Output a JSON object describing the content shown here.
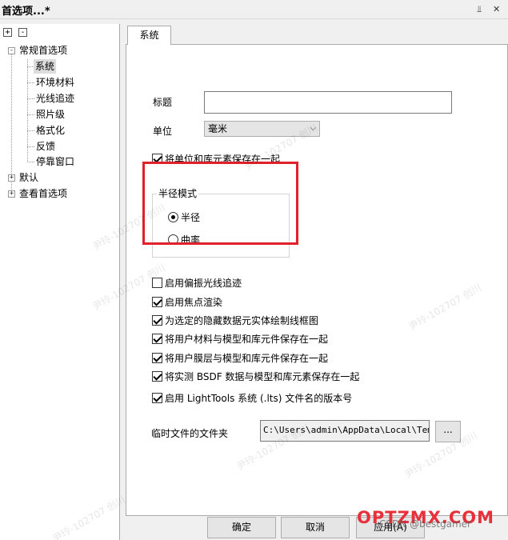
{
  "window": {
    "title": "首选项...*",
    "pin_icon": "pin-icon",
    "close_icon": "close-icon"
  },
  "tree": {
    "expand_all": "+",
    "collapse_all": "-",
    "items": [
      {
        "label": "常规首选项",
        "level": 0,
        "expanded": true
      },
      {
        "label": "系统",
        "level": 1,
        "selected": true
      },
      {
        "label": "环境材料",
        "level": 1
      },
      {
        "label": "光线追迹",
        "level": 1
      },
      {
        "label": "照片级",
        "level": 1
      },
      {
        "label": "格式化",
        "level": 1
      },
      {
        "label": "反馈",
        "level": 1
      },
      {
        "label": "停靠窗口",
        "level": 1
      },
      {
        "label": "默认",
        "level": 0,
        "expanded": false
      },
      {
        "label": "查看首选项",
        "level": 0,
        "expanded": false
      }
    ]
  },
  "tab": {
    "label": "系统"
  },
  "form": {
    "title_label": "标题",
    "title_value": "",
    "unit_label": "单位",
    "unit_value": "毫米",
    "save_units_label": "将单位和库元素保存在一起",
    "save_units_checked": true,
    "radius_group": {
      "title": "半径模式",
      "options": [
        {
          "label": "半径",
          "checked": true
        },
        {
          "label": "曲率",
          "checked": false
        }
      ]
    },
    "checkboxes": [
      {
        "label": "启用偏振光线追迹",
        "checked": false
      },
      {
        "label": "启用焦点渲染",
        "checked": true
      },
      {
        "label": "为选定的隐藏数据元实体绘制线框图",
        "checked": true
      },
      {
        "label": "将用户材料与模型和库元件保存在一起",
        "checked": true
      },
      {
        "label": "将用户膜层与模型和库元件保存在一起",
        "checked": true
      },
      {
        "label": "将实测 BSDF 数据与模型和库元素保存在一起",
        "checked": true
      },
      {
        "label": "启用 LightTools 系统 (.lts) 文件名的版本号",
        "checked": true
      }
    ],
    "temp_folder_label": "临时文件的文件夹",
    "temp_folder_value": "C:\\Users\\admin\\AppData\\Local\\Temp\\",
    "browse_label": "..."
  },
  "buttons": {
    "ok": "确定",
    "cancel": "取消",
    "apply": "应用(A)"
  },
  "watermarks": {
    "repeated": "尹玲-102707 创川",
    "brand": "OPTZMX.COM",
    "csdn": "CSDN @bestgamer"
  },
  "colors": {
    "highlight": "#e0202a",
    "brand": "#e8303a"
  }
}
